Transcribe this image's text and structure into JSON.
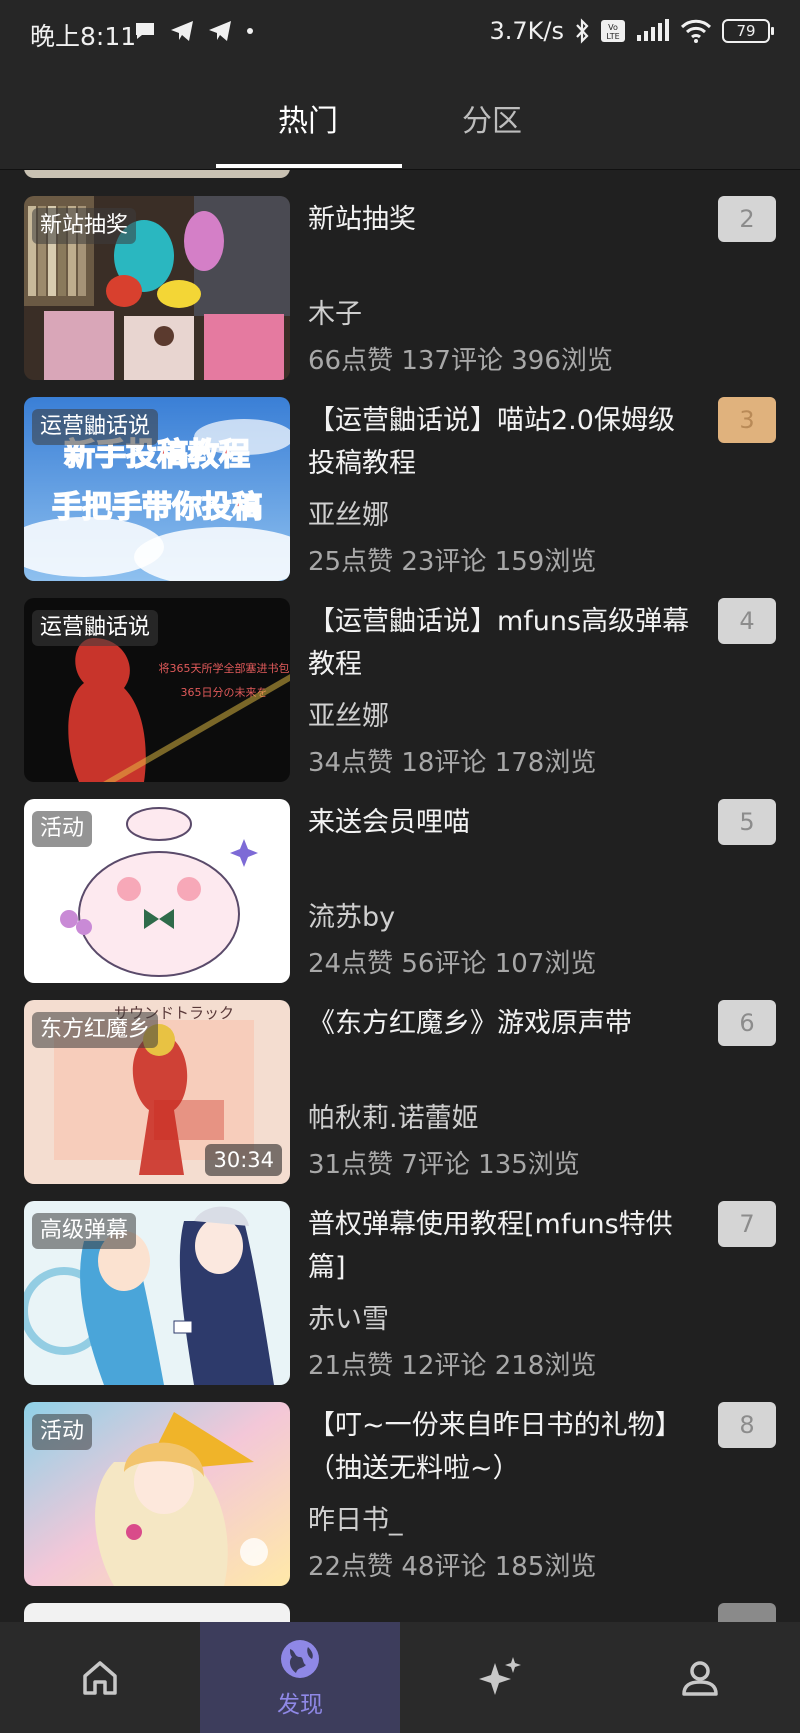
{
  "status_bar": {
    "time": "晚上8:11",
    "speed": "3.7K/s",
    "battery": "79"
  },
  "tabs": [
    {
      "label": "热门",
      "active": true
    },
    {
      "label": "分区",
      "active": false
    }
  ],
  "items": [
    {
      "tag": "新站抽奖",
      "title": "新站抽奖",
      "author": "木子",
      "stats": "66点赞 137评论 396浏览",
      "rank": "2",
      "duration": ""
    },
    {
      "tag": "运营鼬话说",
      "title": "【运营鼬话说】喵站2.0保姆级投稿教程",
      "author": "亚丝娜",
      "stats": "25点赞 23评论 159浏览",
      "rank": "3",
      "duration": ""
    },
    {
      "tag": "运营鼬话说",
      "title": "【运营鼬话说】mfuns高级弹幕教程",
      "author": "亚丝娜",
      "stats": "34点赞 18评论 178浏览",
      "rank": "4",
      "duration": ""
    },
    {
      "tag": "活动",
      "title": "来送会员哩喵",
      "author": "流苏by",
      "stats": "24点赞 56评论 107浏览",
      "rank": "5",
      "duration": ""
    },
    {
      "tag": "东方红魔乡",
      "title": "《东方红魔乡》游戏原声带",
      "author": "帕秋莉.诺蕾姬",
      "stats": "31点赞 7评论 135浏览",
      "rank": "6",
      "duration": "30:34"
    },
    {
      "tag": "高级弹幕",
      "title": "普权弹幕使用教程[mfuns特供篇]",
      "author": "赤い雪",
      "stats": "21点赞 12评论 218浏览",
      "rank": "7",
      "duration": ""
    },
    {
      "tag": "活动",
      "title": "【叮~一份来自昨日书的礼物】（抽送无料啦~）",
      "author": "昨日书_",
      "stats": "22点赞 48评论 185浏览",
      "rank": "8",
      "duration": ""
    }
  ],
  "thumb_texts": {
    "tutorial_line1": "新手投稿教程",
    "tutorial_line2": "手把手带你投稿",
    "danmaku_red1": "将365天所学全部塞进书包",
    "danmaku_red2": "365日分の未来を",
    "touhou_top": "サウンドトラック"
  },
  "bottom_nav": [
    {
      "icon": "home-icon",
      "label": ""
    },
    {
      "icon": "globe-icon",
      "label": "发现",
      "active": true
    },
    {
      "icon": "sparkle-icon",
      "label": ""
    },
    {
      "icon": "user-icon",
      "label": ""
    }
  ],
  "colors": {
    "background": "#202020",
    "accent": "#8f88e6",
    "rank_gold": "#e0b27d",
    "rank_gray": "#d5d5d5"
  }
}
